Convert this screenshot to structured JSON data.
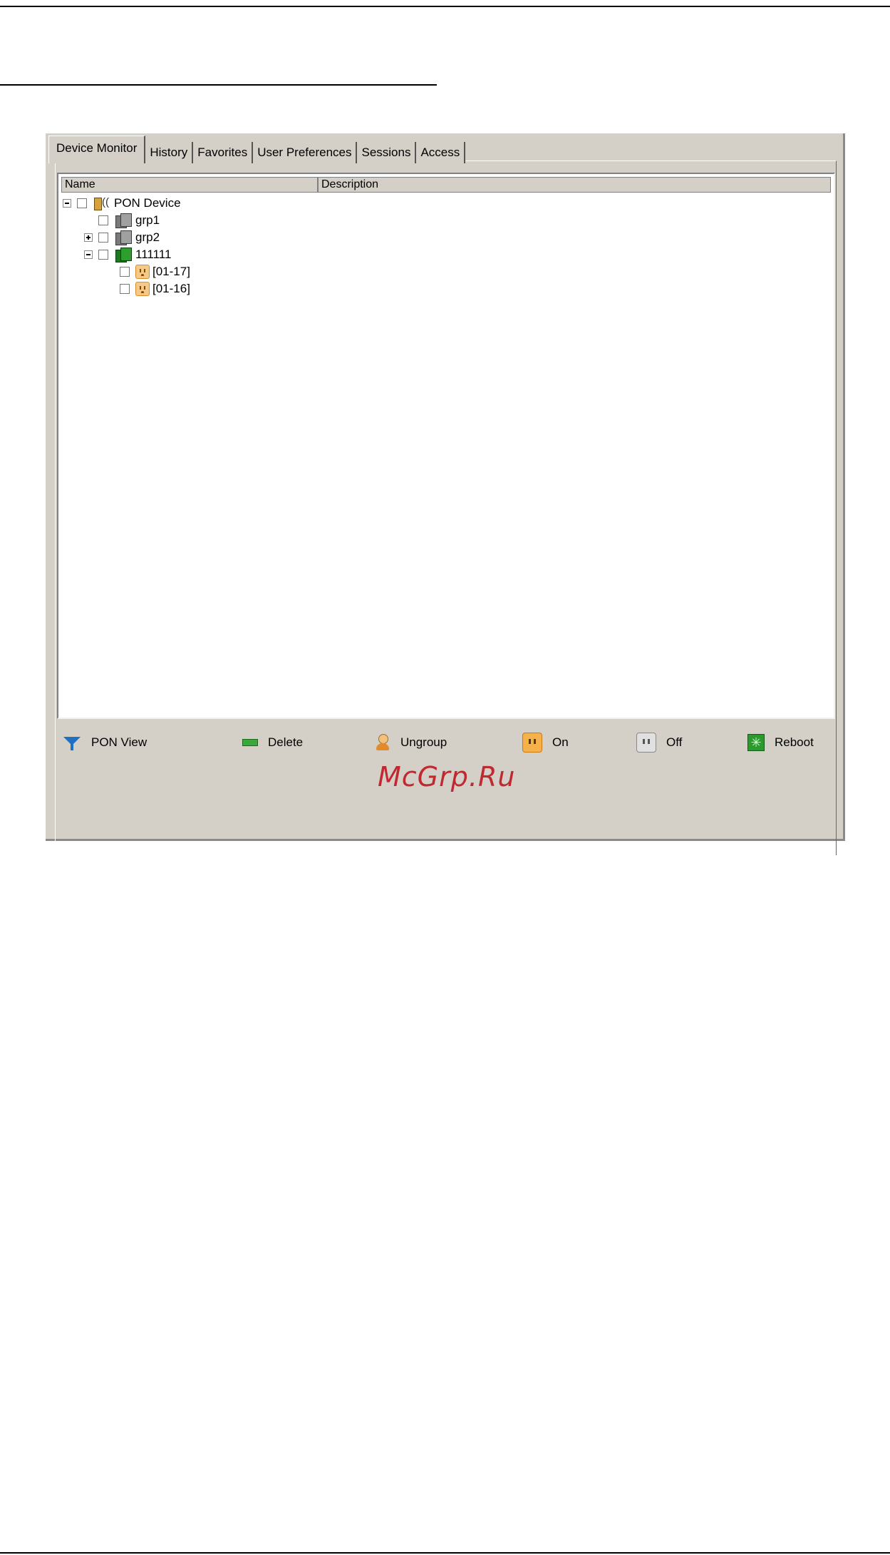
{
  "tabs": [
    {
      "label": "Device Monitor",
      "active": true
    },
    {
      "label": "History",
      "active": false
    },
    {
      "label": "Favorites",
      "active": false
    },
    {
      "label": "User Preferences",
      "active": false
    },
    {
      "label": "Sessions",
      "active": false
    },
    {
      "label": "Access",
      "active": false
    }
  ],
  "tree": {
    "columns": {
      "name": "Name",
      "description": "Description"
    },
    "nodes": {
      "root": {
        "label": "PON Device",
        "icon": "pon-device-icon",
        "expanded": true
      },
      "grp1": {
        "label": "grp1",
        "icon": "group-icon"
      },
      "grp2": {
        "label": "grp2",
        "icon": "group-icon",
        "expanded": false
      },
      "g111111": {
        "label": "111111",
        "icon": "group-active-icon",
        "expanded": true
      },
      "outlet1": {
        "label": "[01-17]",
        "icon": "outlet-icon"
      },
      "outlet2": {
        "label": "[01-16]",
        "icon": "outlet-icon"
      }
    }
  },
  "actions": {
    "pon_view": "PON View",
    "delete": "Delete",
    "ungroup": "Ungroup",
    "on": "On",
    "off": "Off",
    "reboot": "Reboot"
  },
  "watermark": "McGrp.Ru",
  "colors": {
    "window_bg": "#d4d0c8",
    "on_accent": "#f5b14a",
    "reboot_accent": "#2d9a2d",
    "filter_accent": "#1f6fc4",
    "watermark": "#c0292f"
  }
}
